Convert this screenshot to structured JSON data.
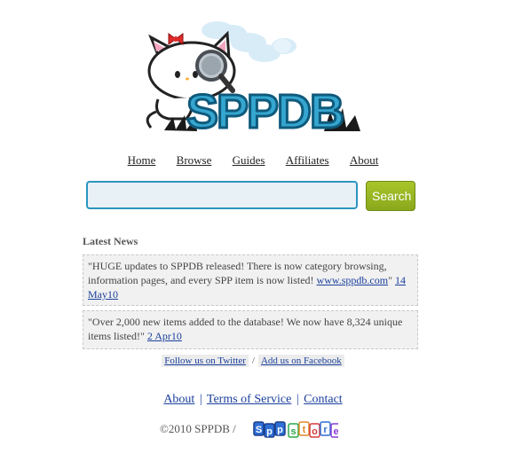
{
  "logo": {
    "text": "SPPDB"
  },
  "nav": {
    "items": [
      "Home",
      "Browse",
      "Guides",
      "Affiliates",
      "About"
    ]
  },
  "search": {
    "value": "",
    "placeholder": "",
    "button_label": "Search"
  },
  "news": {
    "heading": "Latest News",
    "items": [
      {
        "text": "\"HUGE updates to SPPDB released! There is now category browsing, information pages, and every SPP item is now listed! ",
        "link": "www.sppdb.com",
        "text_after": "\" ",
        "date": "14 May10"
      },
      {
        "text": "\"Over 2,000 new items added to the database! We now have 8,324 unique items listed!\" ",
        "link": "",
        "text_after": "",
        "date": "2 Apr10"
      }
    ]
  },
  "social": {
    "twitter": "Follow us on Twitter",
    "separator": "/",
    "facebook": "Add us on Facebook"
  },
  "footer": {
    "links": [
      "About",
      "Terms of Service",
      "Contact"
    ],
    "pipe": "|",
    "copyright": "©2010 SPPDB  /",
    "store_logo_letters": [
      "S",
      "p",
      "p",
      "s",
      "t",
      "o",
      "r",
      "e"
    ]
  },
  "colors": {
    "accent_blue": "#2b95c0",
    "search_green": "#9bb823",
    "link": "#1a3f9c"
  }
}
